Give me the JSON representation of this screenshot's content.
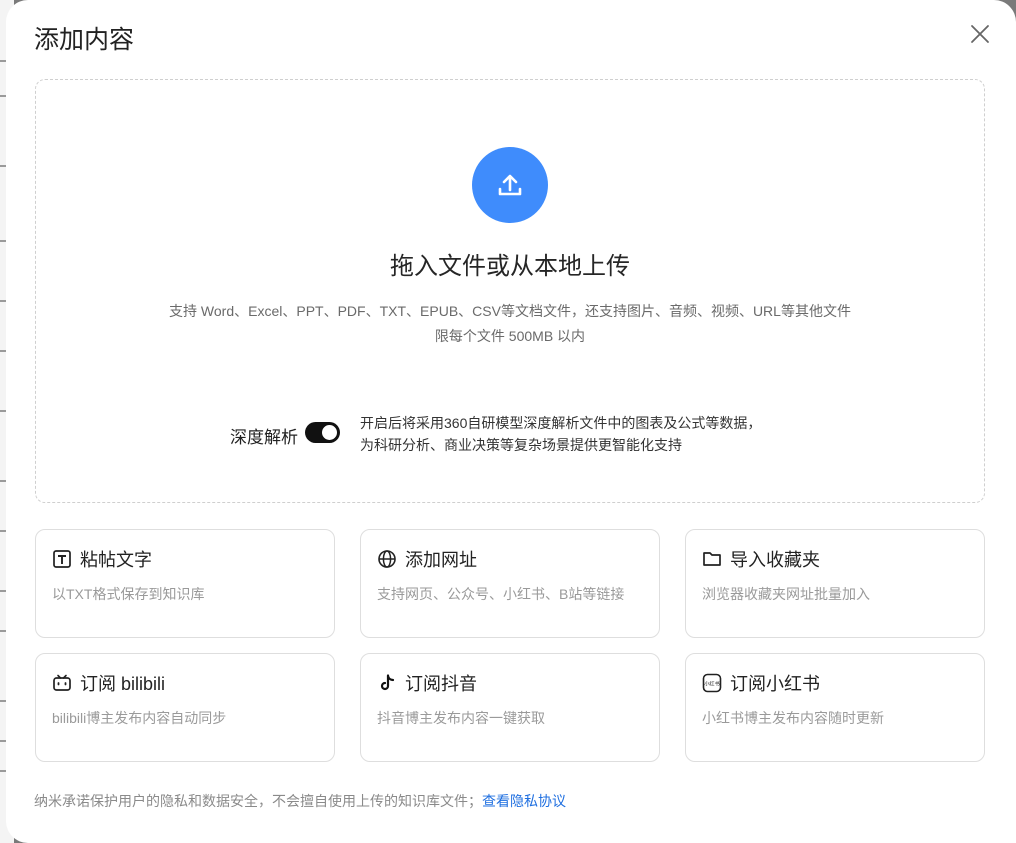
{
  "modal": {
    "title": "添加内容"
  },
  "dropzone": {
    "title": "拖入文件或从本地上传",
    "formats_line": "支持 Word、Excel、PPT、PDF、TXT、EPUB、CSV等文档文件，还支持图片、音频、视频、URL等其他文件",
    "limit_line": "限每个文件 500MB 以内",
    "upload_color": "#3f8cfc"
  },
  "deep_parse": {
    "label": "深度解析",
    "enabled": true,
    "desc_line1": "开启后将采用360自研模型深度解析文件中的图表及公式等数据，",
    "desc_line2": "为科研分析、商业决策等复杂场景提供更智能化支持"
  },
  "options": [
    {
      "icon": "text-box-icon",
      "title": "粘帖文字",
      "desc": "以TXT格式保存到知识库"
    },
    {
      "icon": "globe-icon",
      "title": "添加网址",
      "desc": "支持网页、公众号、小红书、B站等链接"
    },
    {
      "icon": "folder-icon",
      "title": "导入收藏夹",
      "desc": "浏览器收藏夹网址批量加入"
    },
    {
      "icon": "bilibili-icon",
      "title": "订阅 bilibili",
      "desc": "bilibili博主发布内容自动同步"
    },
    {
      "icon": "tiktok-icon",
      "title": "订阅抖音",
      "desc": "抖音博主发布内容一键获取"
    },
    {
      "icon": "xiaohongshu-icon",
      "title": "订阅小红书",
      "desc": "小红书博主发布内容随时更新",
      "icon_text": "小红书"
    }
  ],
  "footer": {
    "text": "纳米承诺保护用户的隐私和数据安全，不会擅自使用上传的知识库文件；",
    "link": "查看隐私协议",
    "link_color": "#1f6fe0"
  }
}
